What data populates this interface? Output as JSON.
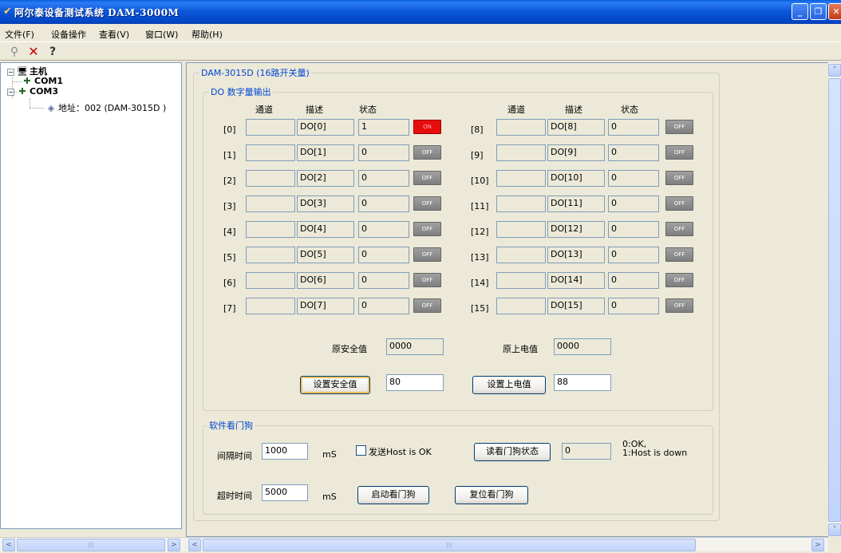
{
  "window": {
    "title": "阿尔泰设备测试系统 DAM-3000M",
    "min_glyph": "_",
    "max_glyph": "❐",
    "close_glyph": "✕"
  },
  "menu": [
    "文件(F)",
    "设备操作",
    "查看(V)",
    "窗口(W)",
    "帮助(H)"
  ],
  "toolbar": {
    "search_icon": "⚲",
    "delete_icon": "✕",
    "help_icon": "?"
  },
  "tree": {
    "root": "主机",
    "com1": "COM1",
    "com3": "COM3",
    "device": "地址：002 (DAM-3015D )",
    "expand_root": "−",
    "expand_com3": "−"
  },
  "panel": {
    "title": "DAM-3015D (16路开关量)",
    "do_group": "DO 数字量输出",
    "headers": {
      "channel": "通道",
      "desc": "描述",
      "state": "状态"
    }
  },
  "channels_left": [
    {
      "index": "[0]",
      "desc": "DO[0]",
      "value": "1",
      "state": "ON"
    },
    {
      "index": "[1]",
      "desc": "DO[1]",
      "value": "0",
      "state": "OFF"
    },
    {
      "index": "[2]",
      "desc": "DO[2]",
      "value": "0",
      "state": "OFF"
    },
    {
      "index": "[3]",
      "desc": "DO[3]",
      "value": "0",
      "state": "OFF"
    },
    {
      "index": "[4]",
      "desc": "DO[4]",
      "value": "0",
      "state": "OFF"
    },
    {
      "index": "[5]",
      "desc": "DO[5]",
      "value": "0",
      "state": "OFF"
    },
    {
      "index": "[6]",
      "desc": "DO[6]",
      "value": "0",
      "state": "OFF"
    },
    {
      "index": "[7]",
      "desc": "DO[7]",
      "value": "0",
      "state": "OFF"
    }
  ],
  "channels_right": [
    {
      "index": "[8]",
      "desc": "DO[8]",
      "value": "0",
      "state": "OFF"
    },
    {
      "index": "[9]",
      "desc": "DO[9]",
      "value": "0",
      "state": "OFF"
    },
    {
      "index": "[10]",
      "desc": "DO[10]",
      "value": "0",
      "state": "OFF"
    },
    {
      "index": "[11]",
      "desc": "DO[11]",
      "value": "0",
      "state": "OFF"
    },
    {
      "index": "[12]",
      "desc": "DO[12]",
      "value": "0",
      "state": "OFF"
    },
    {
      "index": "[13]",
      "desc": "DO[13]",
      "value": "0",
      "state": "OFF"
    },
    {
      "index": "[14]",
      "desc": "DO[14]",
      "value": "0",
      "state": "OFF"
    },
    {
      "index": "[15]",
      "desc": "DO[15]",
      "value": "0",
      "state": "OFF"
    }
  ],
  "safety": {
    "orig_safe_label": "原安全值",
    "orig_safe_value": "0000",
    "orig_power_label": "原上电值",
    "orig_power_value": "0000",
    "set_safe_button": "设置安全值",
    "safe_input": "80",
    "set_power_button": "设置上电值",
    "power_input": "88"
  },
  "watchdog": {
    "group": "软件看门狗",
    "interval_label": "间隔时间",
    "interval_value": "1000",
    "interval_unit": "mS",
    "send_host_ok": "发送Host is OK",
    "read_status_button": "读看门狗状态",
    "status_value": "0",
    "status_legend_1": "0:OK,",
    "status_legend_2": "1:Host is down",
    "timeout_label": "超时时间",
    "timeout_value": "5000",
    "timeout_unit": "mS",
    "start_button": "启动看门狗",
    "reset_button": "复位看门狗"
  },
  "scroll": {
    "left": "<",
    "right": ">",
    "up": "˄",
    "down": "˅",
    "grip": "|||"
  },
  "colors": {
    "title_blue": "#0a55d8",
    "on_red": "#e80d0d",
    "off_gray": "#8c8c8c",
    "legend_blue": "#0046d5"
  }
}
